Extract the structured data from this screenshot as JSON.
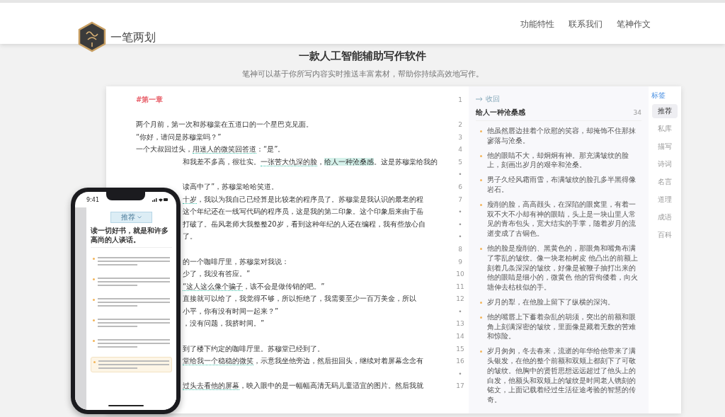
{
  "header": {
    "brand": "一笔两划",
    "nav": [
      {
        "label": "功能特性"
      },
      {
        "label": "联系我们"
      },
      {
        "label": "笔神作文"
      }
    ]
  },
  "hero": {
    "title": "一款人工智能辅助写作软件",
    "subtitle": "笔神可以基于你所写内容实时推送丰富素材，帮助你持续高效地写作。"
  },
  "editor": {
    "heading": "#第一章",
    "heading_number": "1",
    "lines": [
      {
        "kind": "plain"
      },
      {
        "number": "2",
        "kind": "plain",
        "segments": [
          {
            "text": "两个月前，第一次和苏穆棠在五道口的一个星巴克见面。"
          }
        ]
      },
      {
        "number": "3",
        "kind": "plain",
        "segments": [
          {
            "text": "“你好，请问是苏穆棠吗？”"
          }
        ]
      },
      {
        "number": "4",
        "kind": "plain",
        "segments": [
          {
            "text": "一个大叔回过头，"
          },
          {
            "text": "用迷人的微笑回答道",
            "kind": "underline"
          },
          {
            "text": "：“是”。"
          }
        ]
      },
      {
        "number": "5",
        "kind": "covered",
        "segments": [
          {
            "text": "和我差不多高，很壮实。"
          },
          {
            "text": "一张苦大仇深的脸",
            "kind": "underline"
          },
          {
            "text": "，"
          },
          {
            "text": "给人一种沧桑感",
            "kind": "highlight"
          },
          {
            "text": "。这是苏穆棠给我的"
          }
        ]
      },
      {
        "number": "•",
        "kind": "covered"
      },
      {
        "number": "6",
        "kind": "covered",
        "segments": [
          {
            "text": "读高中了”，苏穆棠哈哈笑道。"
          }
        ]
      },
      {
        "number": "7",
        "kind": "covered",
        "segments": [
          {
            "text": "十岁",
            "kind": "underline"
          },
          {
            "text": "，我以为我自己已经算是比较老的程序员了。苏穆棠是我认识的最老的程"
          }
        ]
      },
      {
        "number": "•",
        "kind": "covered",
        "segments": [
          {
            "text": "这个年纪还在一线写代码的程序员，这是我的第二印象。这个印象后来由于岳"
          }
        ]
      },
      {
        "number": "•",
        "kind": "covered",
        "segments": [
          {
            "text": "打破了。岳风老师大我整整20岁，看到这种年纪的人还在编程，我有些放心自"
          }
        ]
      },
      {
        "number": "•",
        "kind": "covered",
        "segments": [
          {
            "text": "了。"
          }
        ]
      },
      {
        "number": "8",
        "kind": "covered"
      },
      {
        "number": "9",
        "kind": "covered",
        "segments": [
          {
            "text": "的一个咖啡厅里，苏穆棠对我说："
          }
        ]
      },
      {
        "number": "10",
        "kind": "covered",
        "segments": [
          {
            "text": "少了，我没有答应。”"
          }
        ]
      },
      {
        "number": "11",
        "kind": "covered",
        "segments": [
          {
            "text": "“这人这么像个骗子",
            "kind": "underline"
          },
          {
            "text": "，该不会是做传销的吧。”"
          }
        ]
      },
      {
        "number": "12",
        "kind": "covered",
        "segments": [
          {
            "text": "直接就可以给了，我觉得不够，所以拒绝了，我需要至少一百万美金，所以"
          }
        ]
      },
      {
        "number": "•",
        "kind": "covered",
        "segments": [
          {
            "text": "小平，你有没有时间一起来？”"
          }
        ]
      },
      {
        "number": "13",
        "kind": "covered",
        "segments": [
          {
            "text": "，没有问题，我挤时间。”"
          }
        ]
      },
      {
        "number": "14",
        "kind": "covered"
      },
      {
        "number": "15",
        "kind": "covered",
        "segments": [
          {
            "text": "到了楼下约定的咖啡厅里。苏穆堂已经到了。"
          }
        ]
      },
      {
        "number": "16",
        "kind": "covered",
        "segments": [
          {
            "text": "堂给我一个稳稳的微笑",
            "kind": "underline"
          },
          {
            "text": "，示意我坐他旁边，然后扭回头，继续对着屏幕念念有"
          }
        ]
      },
      {
        "number": "•",
        "kind": "covered"
      },
      {
        "number": "17",
        "kind": "covered",
        "segments": [
          {
            "text": "过头去看他的屏幕",
            "kind": "underline"
          },
          {
            "text": "，映入眼中的是一幅幅高清无码儿童适宜的图片。然后我就"
          }
        ]
      }
    ]
  },
  "suggestions": {
    "back": "收回",
    "title": "给人一种沧桑感",
    "count": "34",
    "items": [
      "他虽然唇边挂着个欣慰的笑容，却掩饰不住那抹寥落与沧桑。",
      "他的眼睛不大，却炯炯有神。那充满皱纹的脸上，刻画出岁月的艰辛和沧桑。",
      " 男子久经风霜雨雪，布满皱纹的脸孔多半黑得像岩石。",
      "瘦削的脸，高高颧头，在深陷的眼窝里，有着一双不大不小却有神的眼睛，头上是一块山里人常见的青布包头，宽大结实的手掌，随着岁月的流逝变成了古铜色。",
      "他的脸是瘦削的、黑黄色的，那眼角和嘴角布满了零乱的皱纹。像一块老柏树皮 他凸出的前额上刻着几条深深的皱纹，好像是被鞭子抽打出来的他的眼睛是细小的，微黄色 他的背佝偻着，向火塘伸去枯枝似的手。",
      "岁月的犁，在他脸上留下了纵横的深沟。",
      "他的嘴唇上下蓄着杂乱的胡须，突出的前额和眼角上刻满深密的皱纹，里面像是藏着无数的苦难和惊险。",
      "岁月匆匆，冬去春来，流逝的年华给他带来了满头银发，在他的整个前额和双颊上都刻下了可敬的皱纹。他胸中的贤哲思想远远超过了他头上的白发，他额头和双颊上的皱纹是时间老人镌刻的铭文，上面记载着经过生活征途考验的智慧的传奇。"
    ]
  },
  "tags": {
    "label": "标签",
    "items": [
      {
        "label": "推荐",
        "selected": true
      },
      {
        "label": "私库",
        "selected": false
      },
      {
        "label": "描写",
        "selected": false
      },
      {
        "label": "诗词",
        "selected": false
      },
      {
        "label": "名言",
        "selected": false
      },
      {
        "label": "道理",
        "selected": false
      },
      {
        "label": "成语",
        "selected": false
      },
      {
        "label": "百科",
        "selected": false
      }
    ]
  },
  "phone": {
    "time": "9:41",
    "tag": "推荐",
    "quote": "读一切好书，就是和许多高尚的人谈话。",
    "items": [
      {
        "highlighted": false
      },
      {
        "highlighted": false
      },
      {
        "highlighted": false
      },
      {
        "highlighted": false
      },
      {
        "highlighted": false
      },
      {
        "highlighted": true
      }
    ]
  }
}
